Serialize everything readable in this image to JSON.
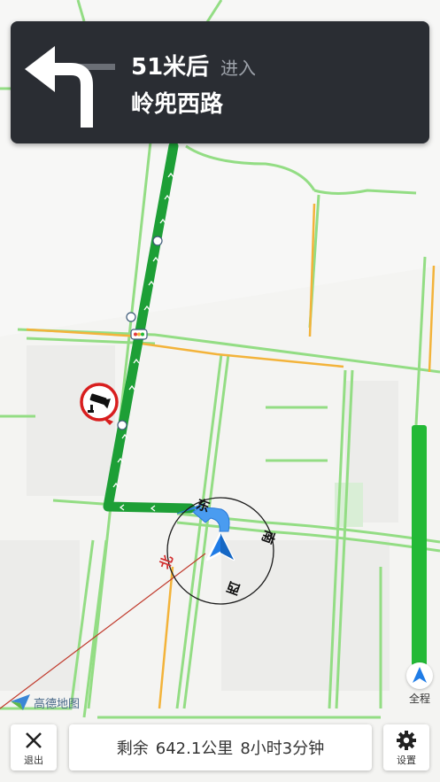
{
  "guidance": {
    "distance": "51米后",
    "action": "进入",
    "road_name": "岭兜西路"
  },
  "compass": {
    "east": "东",
    "south": "南",
    "west": "西",
    "north": "北"
  },
  "brand": {
    "logo_text": "高德地图"
  },
  "overview": {
    "label": "全程"
  },
  "bottom_bar": {
    "exit_label": "退出",
    "remaining_label": "剩余",
    "remaining_distance": "642.1公里",
    "remaining_time": "8小时3分钟",
    "settings_label": "设置"
  },
  "colors": {
    "route": "#1fa33a",
    "banner_bg": "#2a2d33",
    "road_green": "#8ee07e",
    "road_orange": "#f3b33a",
    "navigation_arrow": "#1f7ce6"
  },
  "icons": [
    "turn-left-icon",
    "traffic-camera-icon",
    "navigation-arrow-icon",
    "close-icon",
    "gear-icon",
    "overview-arrow-icon"
  ]
}
